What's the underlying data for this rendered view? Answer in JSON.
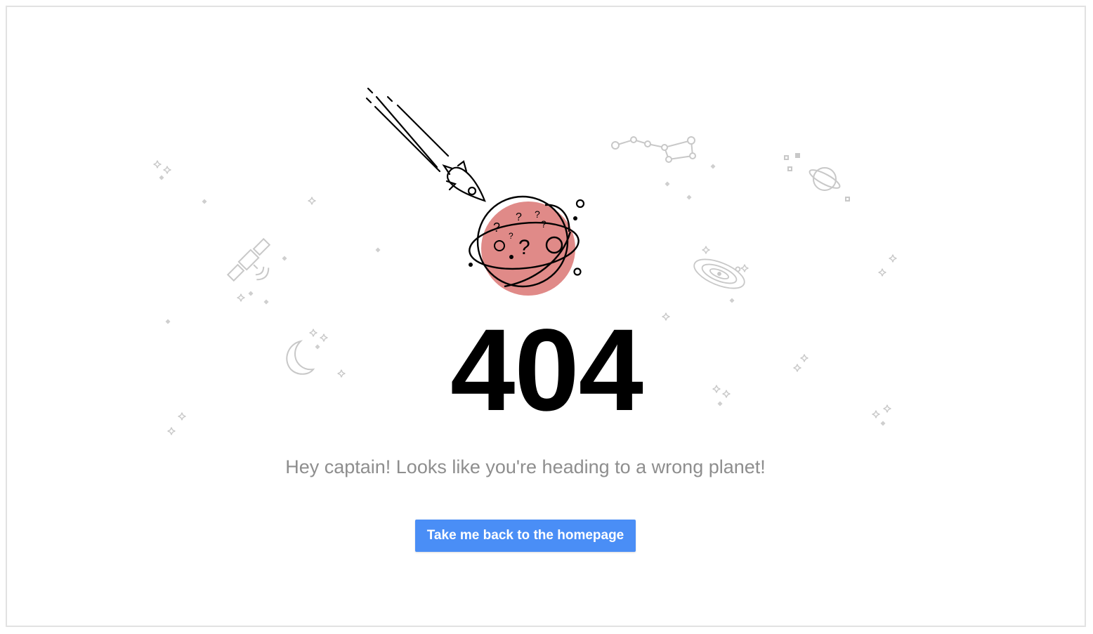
{
  "error": {
    "code": "404",
    "message": "Hey captain! Looks like you're heading to a wrong planet!",
    "button_label": "Take me back to the homepage"
  },
  "colors": {
    "accent": "#4a8ef6",
    "planet": "#e08a88",
    "decoration": "#c8c8c8",
    "message_text": "#8e8e8e"
  },
  "illustration": {
    "icons": [
      "rocket-icon",
      "planet-icon",
      "satellite-icon",
      "moon-icon",
      "constellation-icon",
      "ringed-planet-icon",
      "galaxy-icon",
      "sparkle-icon"
    ]
  }
}
